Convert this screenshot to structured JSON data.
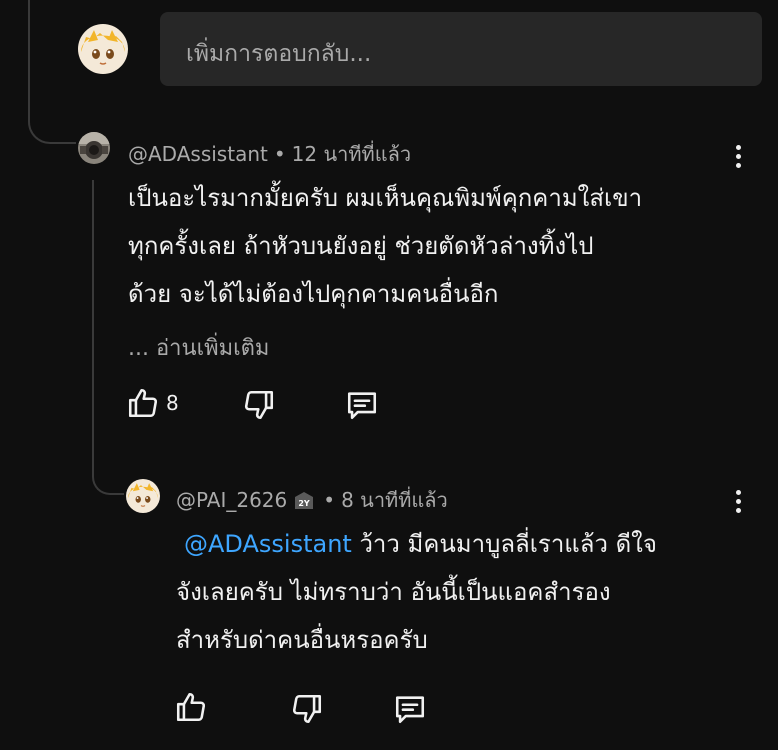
{
  "reply_box": {
    "placeholder": "เพิ่มการตอบกลับ..."
  },
  "comment": {
    "author": "@ADAssistant",
    "time": "12 นาทีที่แล้ว",
    "lines": [
      "เป็นอะไรมากมั้ยครับ ผมเห็นคุณพิมพ์คุกคามใส่เขา",
      "ทุกครั้งเลย ถ้าหัวบนยังอยู่ ช่วยตัดหัวล่างทิ้งไป",
      "ด้วย จะได้ไม่ต้องไปคุกคามคนอื่นอีก"
    ],
    "read_more": "... อ่านเพิ่มเติม",
    "like_count": "8"
  },
  "reply": {
    "author": "@PAI_2626",
    "badge": "2Y",
    "time": "8 นาทีที่แล้ว",
    "mention": "@ADAssistant",
    "line1_rest": " ว้าว มีคนมาบูลลี่เราแล้ว ดีใจ",
    "line2": "จังเลยครับ ไม่ทราบว่า อันนี้เป็นแอคสำรอง",
    "line3": "สำหรับด่าคนอื่นหรอครับ"
  },
  "dot_separator": "•",
  "icons": {
    "like": "thumbs-up-icon",
    "dislike": "thumbs-down-icon",
    "reply": "reply-comment-icon",
    "more": "more-vertical-icon"
  },
  "colors": {
    "background": "#0f0f0f",
    "mention": "#3ea6ff",
    "muted": "#aaaaaa"
  }
}
